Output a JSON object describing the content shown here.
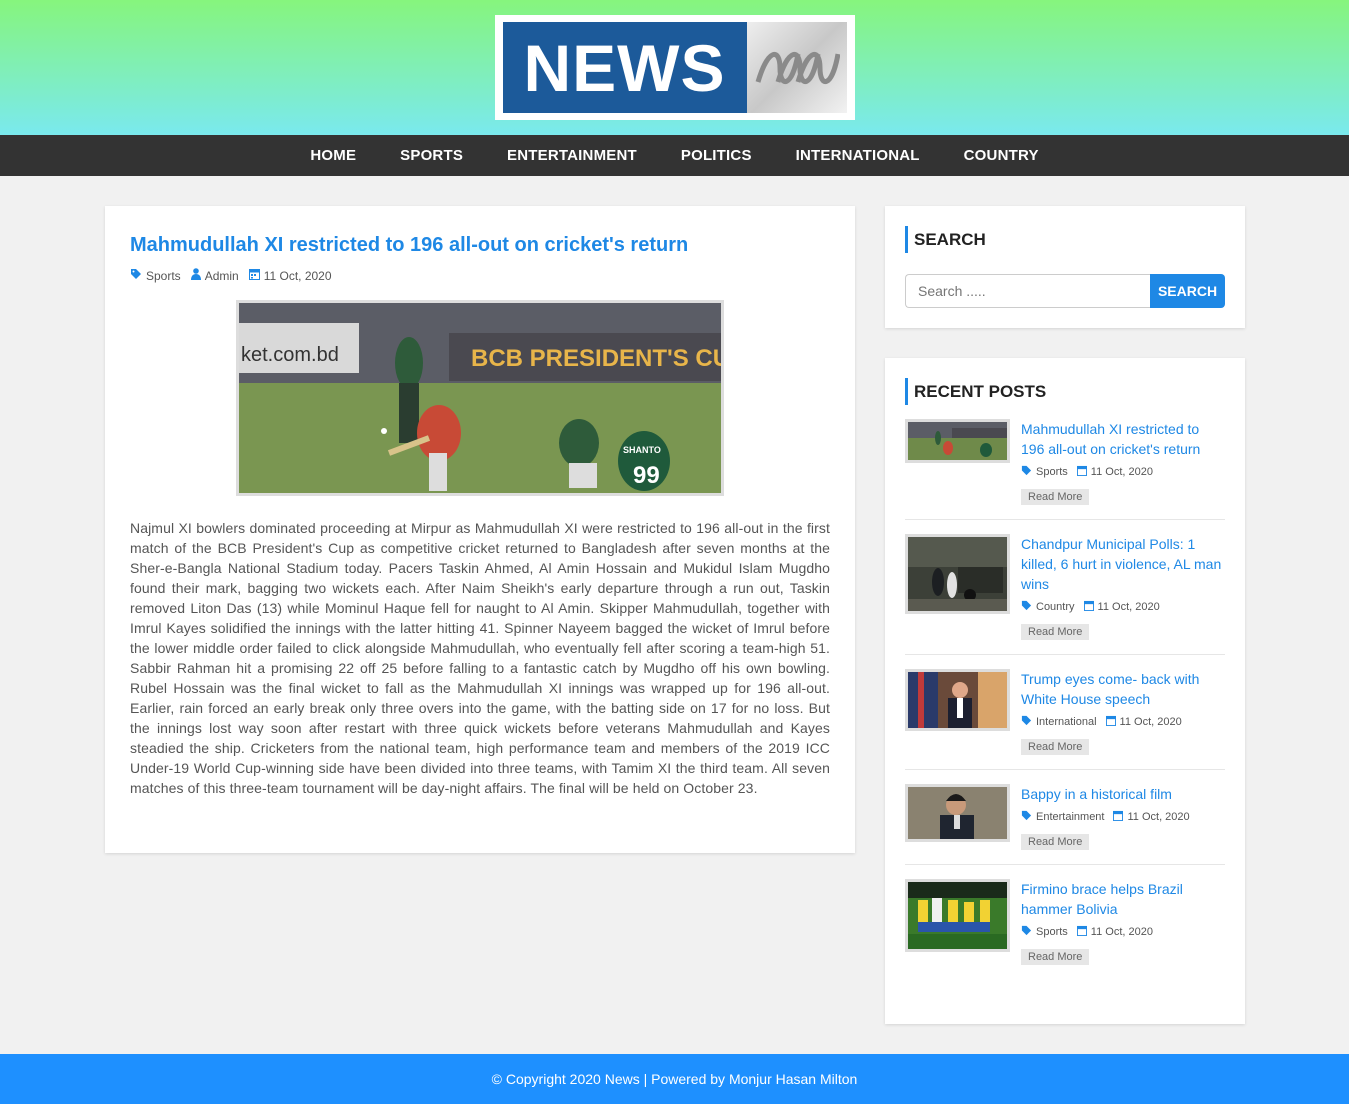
{
  "logo": {
    "text": "NEWS"
  },
  "nav": {
    "items": [
      "HOME",
      "SPORTS",
      "ENTERTAINMENT",
      "POLITICS",
      "INTERNATIONAL",
      "COUNTRY"
    ]
  },
  "post": {
    "title": "Mahmudullah XI restricted to 196 all-out on cricket's return",
    "category": "Sports",
    "author": "Admin",
    "date": "11 Oct, 2020",
    "image": {
      "banner_left": "ket.com.bd",
      "banner_right": "BCB PRESIDENT'S CUP",
      "jersey_number": "99",
      "jersey_name": "SHANTO"
    },
    "body": "Najmul XI bowlers dominated proceeding at Mirpur as Mahmudullah XI were restricted to 196 all-out in the first match of the BCB President's Cup as competitive cricket returned to Bangladesh after seven months at the Sher-e-Bangla National Stadium today. Pacers Taskin Ahmed, Al Amin Hossain and Mukidul Islam Mugdho found their mark, bagging two wickets each. After Naim Sheikh's early departure through a run out, Taskin removed Liton Das (13) while Mominul Haque fell for naught to Al Amin. Skipper Mahmudullah, together with Imrul Kayes solidified the innings with the latter hitting 41. Spinner Nayeem bagged the wicket of Imrul before the lower middle order failed to click alongside Mahmudullah, who eventually fell after scoring a team-high 51. Sabbir Rahman hit a promising 22 off 25 before falling to a fantastic catch by Mugdho off his own bowling. Rubel Hossain was the final wicket to fall as the Mahmudullah XI innings was wrapped up for 196 all-out. Earlier, rain forced an early break only three overs into the game, with the batting side on 17 for no loss. But the innings lost way soon after restart with three quick wickets before veterans Mahmudullah and Kayes steadied the ship. Cricketers from the national team, high performance team and members of the 2019 ICC Under-19 World Cup-winning side have been divided into three teams, with Tamim XI the third team. All seven matches of this three-team tournament will be day-night affairs. The final will be held on October 23."
  },
  "search": {
    "title": "SEARCH",
    "placeholder": "Search .....",
    "button": "SEARCH"
  },
  "recent": {
    "title": "RECENT POSTS",
    "read_more": "Read More",
    "items": [
      {
        "title": "Mahmudullah XI restricted to 196 all-out on cricket's return",
        "category": "Sports",
        "date": "11 Oct, 2020"
      },
      {
        "title": "Chandpur Municipal Polls: 1 killed, 6 hurt in violence, AL man wins",
        "category": "Country",
        "date": "11 Oct, 2020"
      },
      {
        "title": "Trump eyes come- back with White House speech",
        "category": "International",
        "date": "11 Oct, 2020"
      },
      {
        "title": "Bappy in a historical film",
        "category": "Entertainment",
        "date": "11 Oct, 2020"
      },
      {
        "title": "Firmino brace helps Brazil hammer Bolivia",
        "category": "Sports",
        "date": "11 Oct, 2020"
      }
    ]
  },
  "footer": {
    "text": "© Copyright 2020 News | Powered by Monjur Hasan Milton"
  },
  "colors": {
    "accent": "#1e88e5",
    "nav_bg": "#333333",
    "footer_bg": "#1e90ff",
    "header_top": "#86f57d",
    "header_bottom": "#7ae9ee",
    "logo_blue": "#1c5a9a"
  },
  "icons": {
    "category": "tag-icon",
    "author": "user-icon",
    "date": "calendar-icon"
  }
}
